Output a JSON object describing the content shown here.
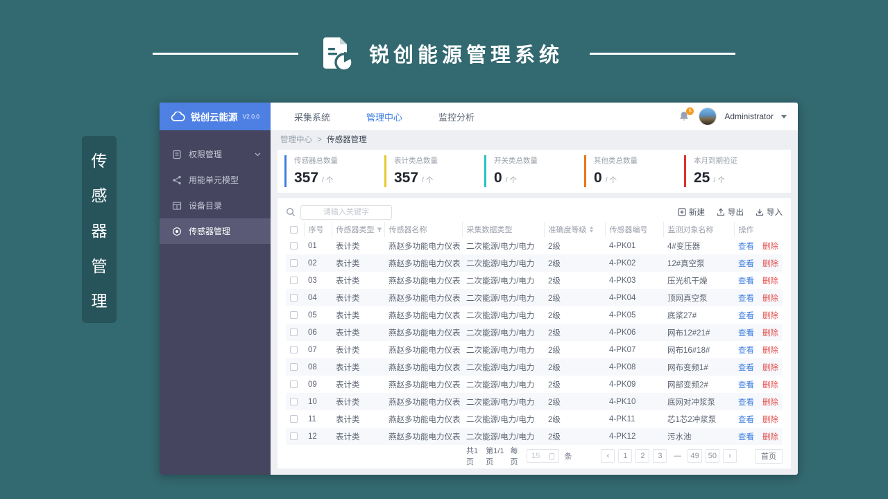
{
  "theme": {
    "page_bg": "#336970",
    "accent_blue": "#3a7be0",
    "delete_red": "#e34d4d",
    "badge_orange": "#f59a23"
  },
  "header": {
    "title": "锐创能源管理系统",
    "icon": "document-pie-icon"
  },
  "side_tag": {
    "chars": [
      "传",
      "感",
      "器",
      "管",
      "理"
    ]
  },
  "window": {
    "logo": {
      "name": "锐创云能源",
      "version": "V2.0.0",
      "icon": "cloud-icon"
    },
    "nav": [
      {
        "label": "采集系统",
        "active": false
      },
      {
        "label": "管理中心",
        "active": true
      },
      {
        "label": "监控分析",
        "active": false
      }
    ],
    "user": {
      "name": "Administrator",
      "badge": "5"
    }
  },
  "sidebar": {
    "items": [
      {
        "label": "权限管理",
        "icon": "permission-doc-icon",
        "has_chevron": true,
        "active": false
      },
      {
        "label": "用能单元模型",
        "icon": "share-nodes-icon",
        "has_chevron": false,
        "active": false
      },
      {
        "label": "设备目录",
        "icon": "grid-catalog-icon",
        "has_chevron": false,
        "active": false
      },
      {
        "label": "传感器管理",
        "icon": "sensor-target-icon",
        "has_chevron": false,
        "active": true
      }
    ]
  },
  "breadcrumb": {
    "parent": "管理中心",
    "separator": ">",
    "current": "传感器管理"
  },
  "stats": [
    {
      "label": "传感器总数量",
      "value": "357",
      "unit": "/ 个",
      "color": "#3e7ee0"
    },
    {
      "label": "表计类总数量",
      "value": "357",
      "unit": "/ 个",
      "color": "#e8c82e"
    },
    {
      "label": "开关类总数量",
      "value": "0",
      "unit": "/ 个",
      "color": "#27c2c2"
    },
    {
      "label": "其他类总数量",
      "value": "0",
      "unit": "/ 个",
      "color": "#e8751a"
    },
    {
      "label": "本月到期验证",
      "value": "25",
      "unit": "/ 个",
      "color": "#e23030"
    }
  ],
  "toolbar": {
    "search_placeholder": "请输入关键字",
    "buttons": [
      {
        "label": "新建",
        "icon": "plus-square-icon"
      },
      {
        "label": "导出",
        "icon": "export-icon"
      },
      {
        "label": "导入",
        "icon": "import-icon"
      }
    ]
  },
  "table": {
    "columns": [
      "序号",
      "传感器类型",
      "传感器名称",
      "采集数据类型",
      "准确度等级",
      "传感器编号",
      "监测对象名称",
      "操作"
    ],
    "action_view": "查看",
    "action_delete": "删除",
    "rows": [
      {
        "no": "01",
        "type": "表计类",
        "name": "燕赵多功能电力仪表",
        "data_type": "二次能源/电力/电力",
        "accuracy": "2级",
        "code": "4-PK01",
        "target": "4#变压器"
      },
      {
        "no": "02",
        "type": "表计类",
        "name": "燕赵多功能电力仪表",
        "data_type": "二次能源/电力/电力",
        "accuracy": "2级",
        "code": "4-PK02",
        "target": "12#真空泵"
      },
      {
        "no": "03",
        "type": "表计类",
        "name": "燕赵多功能电力仪表",
        "data_type": "二次能源/电力/电力",
        "accuracy": "2级",
        "code": "4-PK03",
        "target": "压光机干燥"
      },
      {
        "no": "04",
        "type": "表计类",
        "name": "燕赵多功能电力仪表",
        "data_type": "二次能源/电力/电力",
        "accuracy": "2级",
        "code": "4-PK04",
        "target": "顶网真空泵"
      },
      {
        "no": "05",
        "type": "表计类",
        "name": "燕赵多功能电力仪表",
        "data_type": "二次能源/电力/电力",
        "accuracy": "2级",
        "code": "4-PK05",
        "target": "底浆27#"
      },
      {
        "no": "06",
        "type": "表计类",
        "name": "燕赵多功能电力仪表",
        "data_type": "二次能源/电力/电力",
        "accuracy": "2级",
        "code": "4-PK06",
        "target": "网布12#21#"
      },
      {
        "no": "07",
        "type": "表计类",
        "name": "燕赵多功能电力仪表",
        "data_type": "二次能源/电力/电力",
        "accuracy": "2级",
        "code": "4-PK07",
        "target": "网布16#18#"
      },
      {
        "no": "08",
        "type": "表计类",
        "name": "燕赵多功能电力仪表",
        "data_type": "二次能源/电力/电力",
        "accuracy": "2级",
        "code": "4-PK08",
        "target": "网布变频1#"
      },
      {
        "no": "09",
        "type": "表计类",
        "name": "燕赵多功能电力仪表",
        "data_type": "二次能源/电力/电力",
        "accuracy": "2级",
        "code": "4-PK09",
        "target": "网部变频2#"
      },
      {
        "no": "10",
        "type": "表计类",
        "name": "燕赵多功能电力仪表",
        "data_type": "二次能源/电力/电力",
        "accuracy": "2级",
        "code": "4-PK10",
        "target": "底网对冲浆泵"
      },
      {
        "no": "11",
        "type": "表计类",
        "name": "燕赵多功能电力仪表",
        "data_type": "二次能源/电力/电力",
        "accuracy": "2级",
        "code": "4-PK11",
        "target": "芯1芯2冲浆泵"
      },
      {
        "no": "12",
        "type": "表计类",
        "name": "燕赵多功能电力仪表",
        "data_type": "二次能源/电力/电力",
        "accuracy": "2级",
        "code": "4-PK12",
        "target": "污水池"
      }
    ]
  },
  "pagination": {
    "total_pages": "共1页",
    "current_page": "第1/1页",
    "per_page_label": "每页",
    "per_page_value": "15",
    "unit_label": "条",
    "prev": "‹",
    "next": "›",
    "pages": [
      "1",
      "2",
      "3",
      "—",
      "49",
      "50"
    ],
    "home": "首页"
  }
}
